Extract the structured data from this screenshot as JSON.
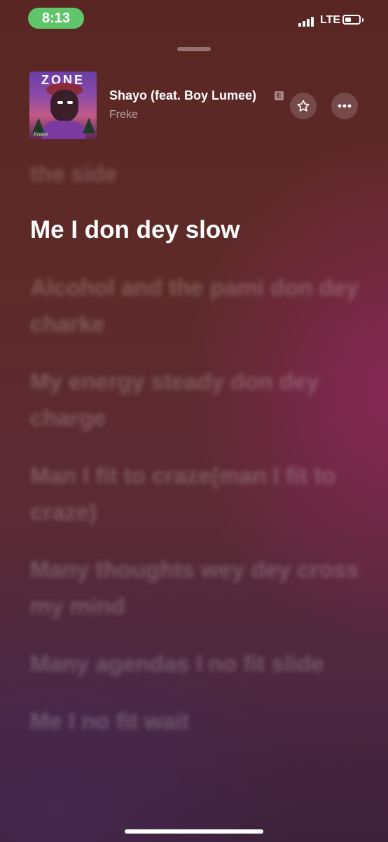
{
  "status_bar": {
    "time": "8:13",
    "network": "LTE",
    "time_pill_color": "#5fc56a"
  },
  "now_playing": {
    "album_art_text": "ZONE",
    "album_art_signature": "Freke",
    "title": "Shayo (feat. Boy Lumee)",
    "explicit_badge": "E",
    "artist": "Freke",
    "icons": [
      "star-icon",
      "more-icon"
    ]
  },
  "lyrics": {
    "previous": "the side",
    "current": "Me I don dey slow",
    "upcoming": [
      "Alcohol and the pami don dey charke",
      "My energy steady don dey charge",
      "Man I fit to craze(man I fit to craze)",
      "Many thoughts wey dey cross my mind",
      "Many agendas I no fit slide",
      "Me I no fit wait"
    ]
  }
}
